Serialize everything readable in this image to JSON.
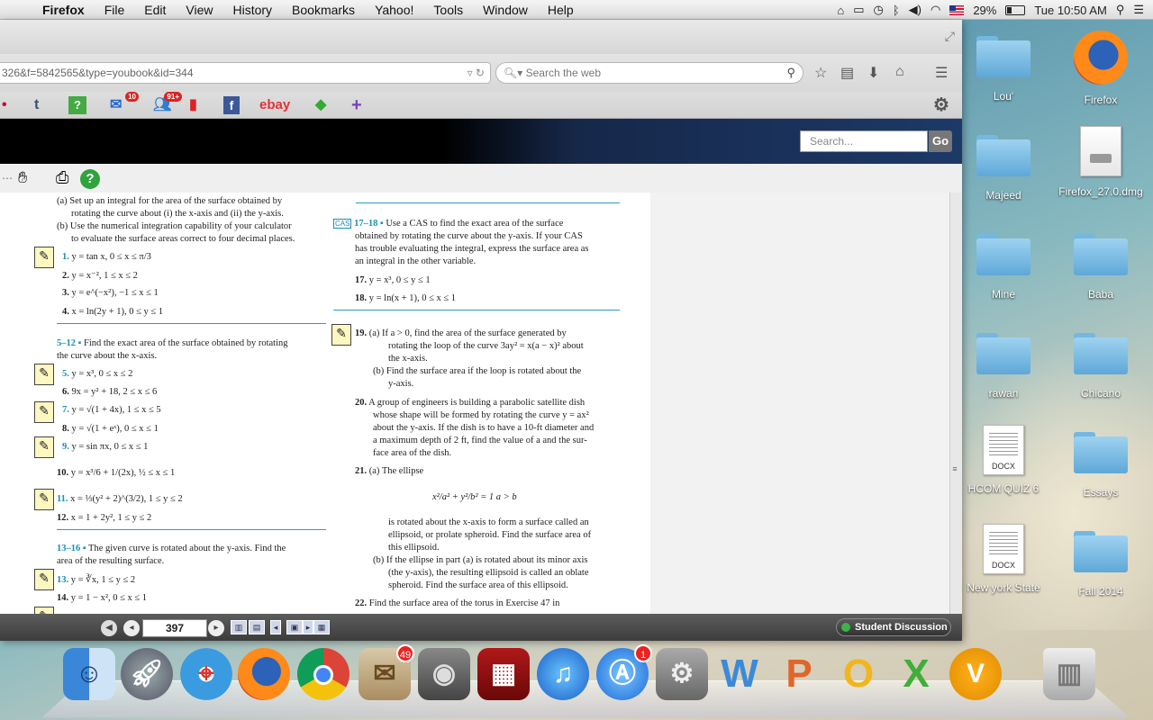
{
  "menubar": {
    "app_name": "Firefox",
    "items": [
      "File",
      "Edit",
      "View",
      "History",
      "Bookmarks",
      "Yahoo!",
      "Tools",
      "Window",
      "Help"
    ],
    "battery": "29%",
    "clock": "Tue 10:50 AM"
  },
  "browser": {
    "url": "326&f=5842565&type=youbook&id=344",
    "search_placeholder": "Search the web",
    "bookmarks": [
      {
        "icon": "tumblr-icon",
        "label": "t"
      },
      {
        "icon": "question-icon",
        "label": "?"
      },
      {
        "icon": "mail-icon",
        "badge": "10"
      },
      {
        "icon": "people-icon",
        "badge": "91+"
      },
      {
        "icon": "bookmark-icon"
      },
      {
        "icon": "facebook-icon",
        "label": "f"
      },
      {
        "icon": "ebay-icon",
        "label": "ebay"
      },
      {
        "icon": "tag-icon"
      },
      {
        "icon": "plus-icon",
        "label": "+"
      }
    ]
  },
  "site": {
    "search_placeholder": "Search...",
    "go_label": "Go"
  },
  "book": {
    "left": {
      "intro_a": "(a) Set up an integral for the area of the surface obtained by",
      "intro_a2": "rotating the curve about (i) the x-axis and (ii) the y-axis.",
      "intro_b": "(b) Use the numerical integration capability of your calculator",
      "intro_b2": "to evaluate the surface areas correct to four decimal places.",
      "ex1": [
        "1.",
        "y = tan x,   0 ≤ x ≤ π/3"
      ],
      "ex2": [
        "2.",
        "y = x⁻²,   1 ≤ x ≤ 2"
      ],
      "ex3": [
        "3.",
        "y = e^(−x²),   −1 ≤ x ≤ 1"
      ],
      "ex4": [
        "4.",
        "x = ln(2y + 1),   0 ≤ y ≤ 1"
      ],
      "sec5_num": "5–12",
      "sec5_text": "Find the exact area of the surface obtained by rotating",
      "sec5_text2": "the curve about the x-axis.",
      "ex5": [
        "5.",
        "y = x³,   0 ≤ x ≤ 2"
      ],
      "ex6": [
        "6.",
        "9x = y² + 18,   2 ≤ x ≤ 6"
      ],
      "ex7": [
        "7.",
        "y = √(1 + 4x),   1 ≤ x ≤ 5"
      ],
      "ex8": [
        "8.",
        "y = √(1 + eˣ),   0 ≤ x ≤ 1"
      ],
      "ex9": [
        "9.",
        "y = sin πx,   0 ≤ x ≤ 1"
      ],
      "ex10": [
        "10.",
        "y = x³/6 + 1/(2x),   ½ ≤ x ≤ 1"
      ],
      "ex11": [
        "11.",
        "x = ⅓(y² + 2)^(3/2),   1 ≤ y ≤ 2"
      ],
      "ex12": [
        "12.",
        "x = 1 + 2y²,   1 ≤ y ≤ 2"
      ],
      "sec13_num": "13–16",
      "sec13_text": "The given curve is rotated about the y-axis. Find the",
      "sec13_text2": "area of the resulting surface.",
      "ex13": [
        "13.",
        "y = ∛x,   1 ≤ y ≤ 2"
      ],
      "ex14": [
        "14.",
        "y = 1 − x²,   0 ≤ x ≤ 1"
      ]
    },
    "right": {
      "sec17_num": "17–18",
      "sec17_text": "Use a CAS to find the exact area of the surface",
      "sec17_l2": "obtained by rotating the curve about the y-axis. If your CAS",
      "sec17_l3": "has trouble evaluating the integral, express the surface area as",
      "sec17_l4": "an integral in the other variable.",
      "ex17": [
        "17.",
        "y = x³,   0 ≤ y ≤ 1"
      ],
      "ex18": [
        "18.",
        "y = ln(x + 1),   0 ≤ x ≤ 1"
      ],
      "ex19_num": "19.",
      "ex19_a1": "(a) If a > 0, find the area of the surface generated by",
      "ex19_a2": "rotating the loop of the curve 3ay² = x(a − x)² about",
      "ex19_a3": "the x-axis.",
      "ex19_b1": "(b) Find the surface area if the loop is rotated about the",
      "ex19_b2": "y-axis.",
      "ex20_num": "20.",
      "ex20_l1": "A group of engineers is building a parabolic satellite dish",
      "ex20_l2": "whose shape will be formed by rotating the curve y = ax²",
      "ex20_l3": "about the y-axis. If the dish is to have a 10-ft diameter and",
      "ex20_l4": "a maximum depth of 2 ft, find the value of a and the sur-",
      "ex20_l5": "face area of the dish.",
      "ex21_num": "21.",
      "ex21_a": "(a) The ellipse",
      "ex21_eq": "x²/a² + y²/b² = 1       a > b",
      "ex21_l1": "is rotated about the x-axis to form a surface called an",
      "ex21_l2": "ellipsoid, or prolate spheroid. Find the surface area of",
      "ex21_l3": "this ellipsoid.",
      "ex21_b1": "(b) If the ellipse in part (a) is rotated about its minor axis",
      "ex21_b2": "(the y-axis), the resulting ellipsoid is called an oblate",
      "ex21_b3": "spheroid. Find the surface area of this ellipsoid.",
      "ex22_num": "22.",
      "ex22_l1": "Find the surface area of the torus in Exercise 47 in"
    }
  },
  "reader_nav": {
    "page": "397",
    "student_discussion": "Student Discussion"
  },
  "desktop": {
    "items": [
      {
        "label": "Lou'",
        "type": "folder"
      },
      {
        "label": "Firefox",
        "type": "app"
      },
      {
        "label": "Majeed",
        "type": "folder"
      },
      {
        "label": "Firefox_27.0.dmg",
        "type": "disk"
      },
      {
        "label": "Mine",
        "type": "folder"
      },
      {
        "label": "Baba",
        "type": "folder"
      },
      {
        "label": "rawan",
        "type": "folder"
      },
      {
        "label": "Chicano",
        "type": "folder"
      },
      {
        "label": "HCOM QUIZ 6",
        "type": "doc",
        "ext": "DOCX"
      },
      {
        "label": "Essays",
        "type": "folder"
      },
      {
        "label": "New york State",
        "type": "doc",
        "ext": "DOCX"
      },
      {
        "label": "Fall 2014",
        "type": "folder"
      }
    ]
  },
  "dock": {
    "apps": [
      {
        "name": "finder"
      },
      {
        "name": "launchpad"
      },
      {
        "name": "safari"
      },
      {
        "name": "firefox"
      },
      {
        "name": "chrome"
      },
      {
        "name": "mail",
        "badge": "49"
      },
      {
        "name": "facetime"
      },
      {
        "name": "photo-booth"
      },
      {
        "name": "itunes"
      },
      {
        "name": "app-store",
        "badge": "1"
      },
      {
        "name": "system-preferences"
      },
      {
        "name": "word",
        "label": "W"
      },
      {
        "name": "powerpoint",
        "label": "P"
      },
      {
        "name": "outlook",
        "label": "O"
      },
      {
        "name": "excel",
        "label": "X"
      },
      {
        "name": "vonage",
        "label": "V"
      },
      {
        "name": "trash"
      }
    ]
  },
  "colors": {
    "accent_blue": "#1a8fb5",
    "discussion_green": "#3cb34a",
    "site_header": "#000000"
  }
}
